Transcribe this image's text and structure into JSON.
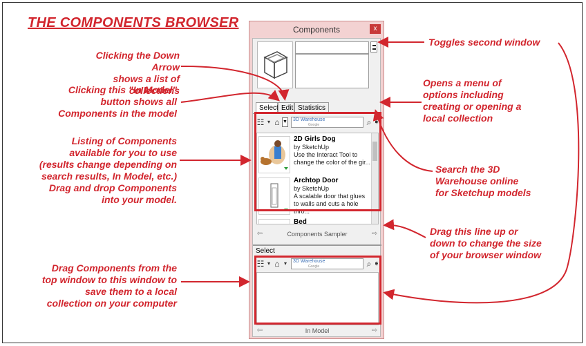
{
  "title": "THE COMPONENTS BROWSER",
  "annotations": {
    "down_arrow": [
      "Clicking the Down Arrow",
      "shows a list of collections"
    ],
    "in_model": [
      "Clicking this \"In Model\"",
      "button shows all",
      "Components in the model"
    ],
    "listing": [
      "Listing of Components",
      "available for you to use",
      "(results change depending on",
      "search results, In Model, etc.)",
      "Drag and drop Components",
      "into your model."
    ],
    "drag_down": [
      "Drag Components from the",
      "top window to this window to",
      "save them to a local",
      "collection on your computer"
    ],
    "toggles": [
      "Toggles second window"
    ],
    "opens_menu": [
      "Opens a menu of",
      "options including",
      "creating or opening a",
      "local collection"
    ],
    "search": [
      "Search the 3D",
      "Warehouse online",
      "for Sketchup models"
    ],
    "drag_line": [
      "Drag this line up or",
      "down to change the size",
      "of your browser window"
    ]
  },
  "window": {
    "title": "Components",
    "close": "x",
    "tabs": [
      "Select",
      "Edit",
      "Statistics"
    ],
    "search_placeholder": "3D Warehouse",
    "search_sub": "Google",
    "items": [
      {
        "name": "2D Girls Dog",
        "by": "by SketchUp",
        "desc": "Use the Interact Tool to change the color of the gir..."
      },
      {
        "name": "Archtop Door",
        "by": "by SketchUp",
        "desc": "A scalable door that glues to walls and cuts a hole thro..."
      },
      {
        "name": "Bed",
        "by": "",
        "desc": ""
      }
    ],
    "collection_top": "Components Sampler",
    "second_select": "Select",
    "collection_bottom": "In Model"
  },
  "colors": {
    "annotation": "#d2262e",
    "window_frame": "#f3d2d2"
  }
}
